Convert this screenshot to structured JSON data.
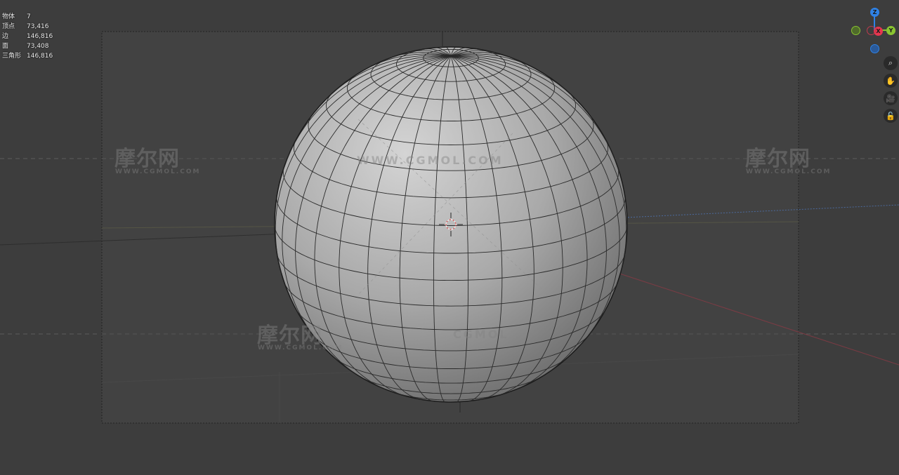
{
  "stats": {
    "objects_label": "物体",
    "objects_value": "7",
    "vertices_label": "顶点",
    "vertices_value": "73,416",
    "edges_label": "边",
    "edges_value": "146,816",
    "faces_label": "面",
    "faces_value": "73,408",
    "triangles_label": "三角形",
    "triangles_value": "146,816"
  },
  "gizmo": {
    "z_label": "Z",
    "x_label": "X",
    "y_label": "Y",
    "colors": {
      "x": "#e8364f",
      "y": "#8ac531",
      "z": "#2f82e6"
    }
  },
  "tools": [
    {
      "name": "zoom-icon",
      "glyph": "⌕"
    },
    {
      "name": "hand-pan-icon",
      "glyph": "✋"
    },
    {
      "name": "camera-icon",
      "glyph": "🎥"
    },
    {
      "name": "lock-icon",
      "glyph": "🔓"
    }
  ],
  "watermarks": {
    "brand_cn": "摩尔网",
    "brand_url": "WWW.CGMOL.COM",
    "brand_center": "WWW.CGMOL.COM",
    "brand_mid": "CGMOL"
  }
}
